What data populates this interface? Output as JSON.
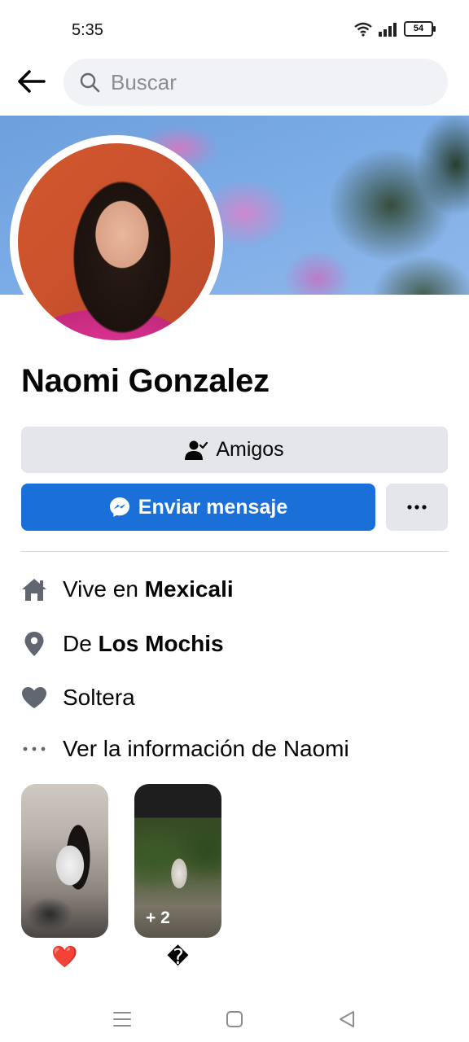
{
  "status_bar": {
    "time": "5:35",
    "battery": "54",
    "icons": [
      "wifi-icon",
      "signal-icon",
      "battery-icon"
    ]
  },
  "header": {
    "back_icon": "arrow-left-icon",
    "search_placeholder": "Buscar",
    "search_value": ""
  },
  "profile": {
    "name": "Naomi Gonzalez"
  },
  "actions": {
    "friends_label": "Amigos",
    "message_label": "Enviar mensaje",
    "more_icon": "more-horizontal-icon"
  },
  "info": {
    "lives_prefix": "Vive en ",
    "lives_city": "Mexicali",
    "from_prefix": "De ",
    "from_city": "Los Mochis",
    "relationship": "Soltera",
    "see_more": "Ver la información de Naomi"
  },
  "stories": [
    {
      "reaction": "❤️"
    },
    {
      "badge": "+ 2",
      "reaction": "�"
    }
  ],
  "colors": {
    "accent": "#1b6fd9",
    "button_gray": "#e4e6eb",
    "icon_gray": "#606770"
  }
}
